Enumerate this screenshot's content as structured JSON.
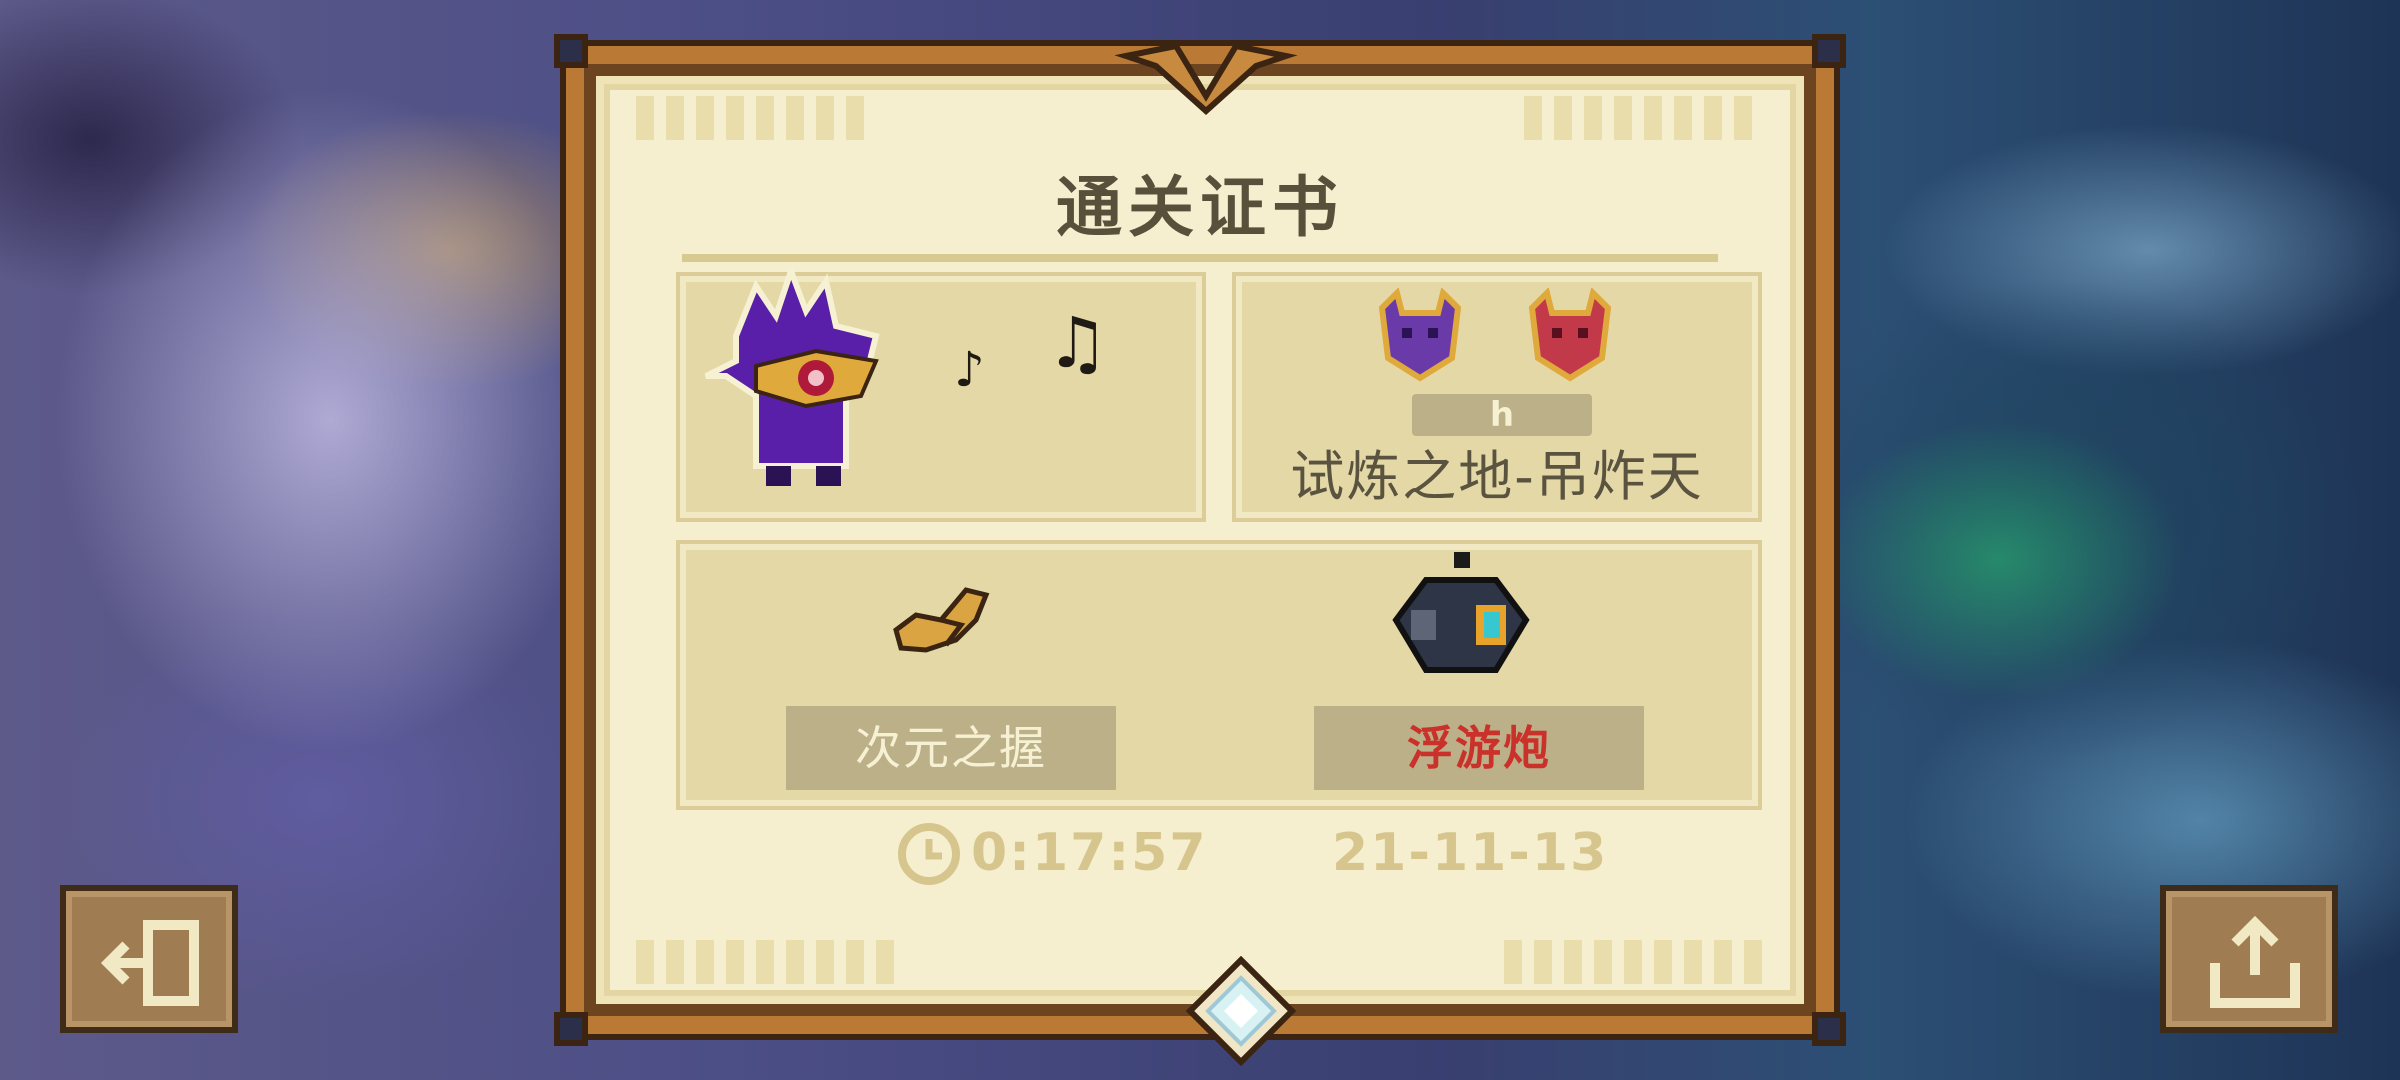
{
  "certificate": {
    "title": "通关证书",
    "stage_badge": "h",
    "stage_name": "试炼之地-吊炸天",
    "items": [
      {
        "label": "次元之握",
        "label_color": "#f7f1d4"
      },
      {
        "label": "浮游炮",
        "label_color": "#c9312a"
      }
    ],
    "run_time": "0:17:57",
    "run_date": "21-11-13"
  },
  "icons": {
    "hero": "hooded-purple-hero-icon",
    "music": "music-notes-icon",
    "boss_1": "purple-demon-head-icon",
    "boss_2": "red-demon-head-icon",
    "weapon": "golden-claw-icon",
    "pet": "floating-cannon-icon",
    "clock": "clock-icon",
    "gem": "crystal-gem-icon",
    "exit": "exit-door-icon",
    "share": "share-upload-icon"
  },
  "colors": {
    "frame": "#ba7a35",
    "paper": "#f6efcf",
    "panel": "#e4d8a6",
    "highlight_red": "#c9312a"
  }
}
